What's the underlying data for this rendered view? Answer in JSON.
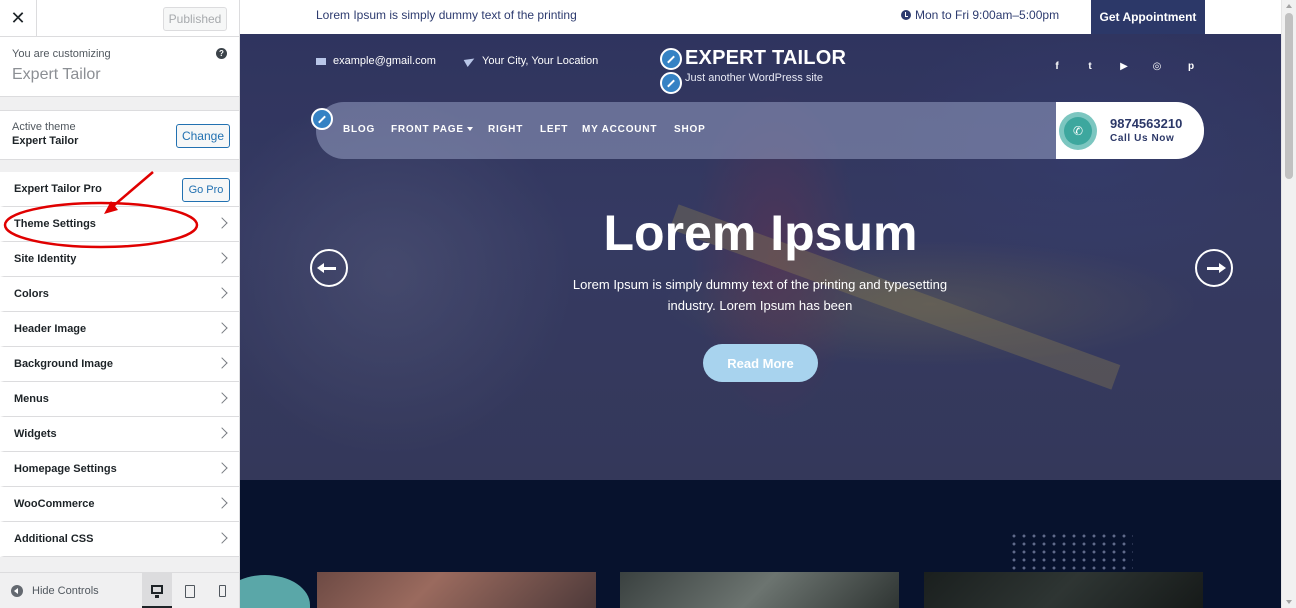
{
  "customizer": {
    "close_label": "✕",
    "published_label": "Published",
    "customizing_label": "You are customizing",
    "site_name": "Expert Tailor",
    "help_label": "?",
    "active_theme_label": "Active theme",
    "active_theme_name": "Expert Tailor",
    "change_label": "Change",
    "pro": {
      "label": "Expert Tailor Pro",
      "button": "Go Pro"
    },
    "sections": [
      "Theme Settings",
      "Site Identity",
      "Colors",
      "Header Image",
      "Background Image",
      "Menus",
      "Widgets",
      "Homepage Settings",
      "WooCommerce",
      "Additional CSS"
    ],
    "footer": {
      "hide_label": "Hide Controls"
    },
    "annotation_color": "#e00000"
  },
  "preview": {
    "topbar": {
      "text": "Lorem Ipsum is simply dummy text of the printing",
      "hours": "Mon to Fri 9:00am–5:00pm",
      "appointment": "Get Appointment"
    },
    "contact": {
      "email": "example@gmail.com",
      "location": "Your City, Your Location"
    },
    "brand": {
      "title": "EXPERT TAILOR",
      "tagline": "Just another WordPress site"
    },
    "social": [
      "f",
      "t",
      "▶",
      "◎",
      "p"
    ],
    "nav": {
      "items": [
        "BLOG",
        "FRONT PAGE",
        "RIGHT",
        "LEFT",
        "MY ACCOUNT",
        "SHOP"
      ],
      "phone": "9874563210",
      "call_label": "Call Us Now"
    },
    "hero": {
      "title": "Lorem Ipsum",
      "subtitle": "Lorem Ipsum is simply dummy text of the printing and typesetting industry. Lorem Ipsum has been",
      "button": "Read More"
    },
    "colors": {
      "navy": "#2c3868",
      "dark_section": "#07122d",
      "button_light_blue": "#a8d3ee",
      "teal": "#3da79e",
      "edit_blue": "#3582c4"
    }
  }
}
